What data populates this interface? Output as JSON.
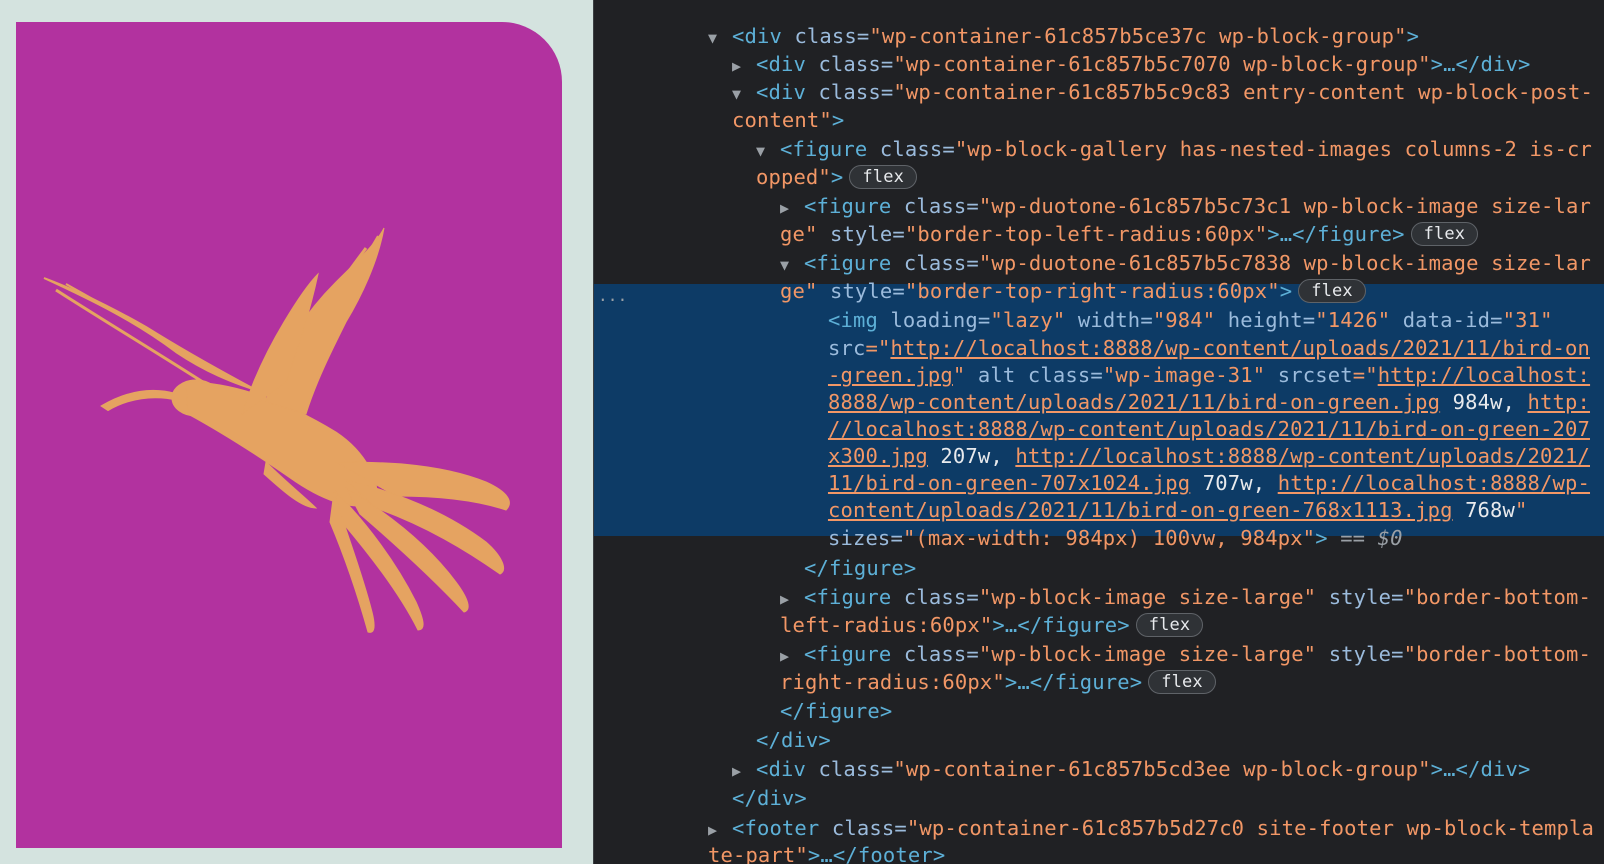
{
  "colors": {
    "preview_bg": "#d4e3df",
    "image_bg": "#b2329f",
    "bird": "#e5a361",
    "panel_bg": "#202124",
    "selection": "#0d3b66"
  },
  "devtools": {
    "badge": "flex",
    "ellipsis": "...",
    "selected_marker": "== $0",
    "lines": {
      "l0": {
        "open": "<div",
        "attr": "class",
        "val": "\"wp-container-61c857b5ce37c wp-block-group\"",
        "close": ">"
      },
      "l1": {
        "open": "<div",
        "attr": "class",
        "val": "\"wp-container-61c857b5c7070 wp-block-group\"",
        "close": ">…</div>"
      },
      "l2": {
        "open": "<div",
        "attr": "class",
        "val": "\"wp-container-61c857b5c9c83 entry-content wp-block-post-"
      },
      "l3": {
        "val": "content\"",
        "close": ">"
      },
      "l4": {
        "open": "<figure",
        "attr": "class",
        "val": "\"wp-block-gallery has-nested-images columns-2 is-cr"
      },
      "l5": {
        "val": "opped\"",
        "close": ">"
      },
      "l6": {
        "open": "<figure",
        "attr": "class",
        "val": "\"wp-duotone-61c857b5c73c1 wp-block-image size-lar"
      },
      "l7": {
        "val": "ge\"",
        "attr": "style",
        "val2": "\"border-top-left-radius:60px\"",
        "close": ">…</figure>"
      },
      "l8": {
        "open": "<figure",
        "attr": "class",
        "val": "\"wp-duotone-61c857b5c7838 wp-block-image size-lar"
      },
      "l9": {
        "val": "ge\"",
        "attr": "style",
        "val2": "\"border-top-right-radius:60px\"",
        "close": ">"
      },
      "l10": {
        "open": "<img",
        "a1": "loading",
        "v1": "\"lazy\"",
        "a2": "width",
        "v2": "\"984\"",
        "a3": "height",
        "v3": "\"1426\"",
        "a4": "data-id",
        "v4": "\"31\""
      },
      "l11": {
        "a1": "src",
        "q": "=\"",
        "link": "http://localhost:8888/wp-content/uploads/2021/11/bird-on"
      },
      "l12": {
        "link": "-green.jpg",
        "q": "\"",
        "a1": "alt",
        "a2": "class",
        "v2": "\"wp-image-31\"",
        "a3": "srcset",
        "q2": "=\"",
        "link2": "http://localhost:"
      },
      "l13": {
        "link": "8888/wp-content/uploads/2021/11/bird-on-green.jpg",
        "txt": " 984w,",
        "link2": "http:"
      },
      "l14": {
        "link": "//localhost:8888/wp-content/uploads/2021/11/bird-on-green-207"
      },
      "l15": {
        "link": "x300.jpg",
        "txt": " 207w,",
        "link2": "http://localhost:8888/wp-content/uploads/2021/"
      },
      "l16": {
        "link": "11/bird-on-green-707x1024.jpg",
        "txt": " 707w,",
        "link2": "http://localhost:8888/wp-"
      },
      "l17": {
        "link": "content/uploads/2021/11/bird-on-green-768x1113.jpg",
        "txt": " 768w",
        "q": "\""
      },
      "l18": {
        "a1": "sizes",
        "v1": "\"(max-width: 984px) 100vw, 984px\"",
        "close": ">"
      },
      "l19": {
        "close": "</figure>"
      },
      "l20": {
        "open": "<figure",
        "attr": "class",
        "val": "\"wp-block-image size-large\"",
        "attr2": "style",
        "val2": "\"border-bottom-"
      },
      "l21": {
        "val": "left-radius:60px\"",
        "close": ">…</figure>"
      },
      "l22": {
        "open": "<figure",
        "attr": "class",
        "val": "\"wp-block-image size-large\"",
        "attr2": "style",
        "val2": "\"border-bottom-"
      },
      "l23": {
        "val": "right-radius:60px\"",
        "close": ">…</figure>"
      },
      "l24": {
        "close": "</figure>"
      },
      "l25": {
        "close": "</div>"
      },
      "l26": {
        "open": "<div",
        "attr": "class",
        "val": "\"wp-container-61c857b5cd3ee wp-block-group\"",
        "close": ">…</div>"
      },
      "l27": {
        "close": "</div>"
      },
      "l28": {
        "open": "<footer",
        "attr": "class",
        "val": "\"wp-container-61c857b5d27c0 site-footer wp-block-templa"
      },
      "l29": {
        "val": "te-part\"",
        "close": ">…</footer>"
      }
    }
  }
}
